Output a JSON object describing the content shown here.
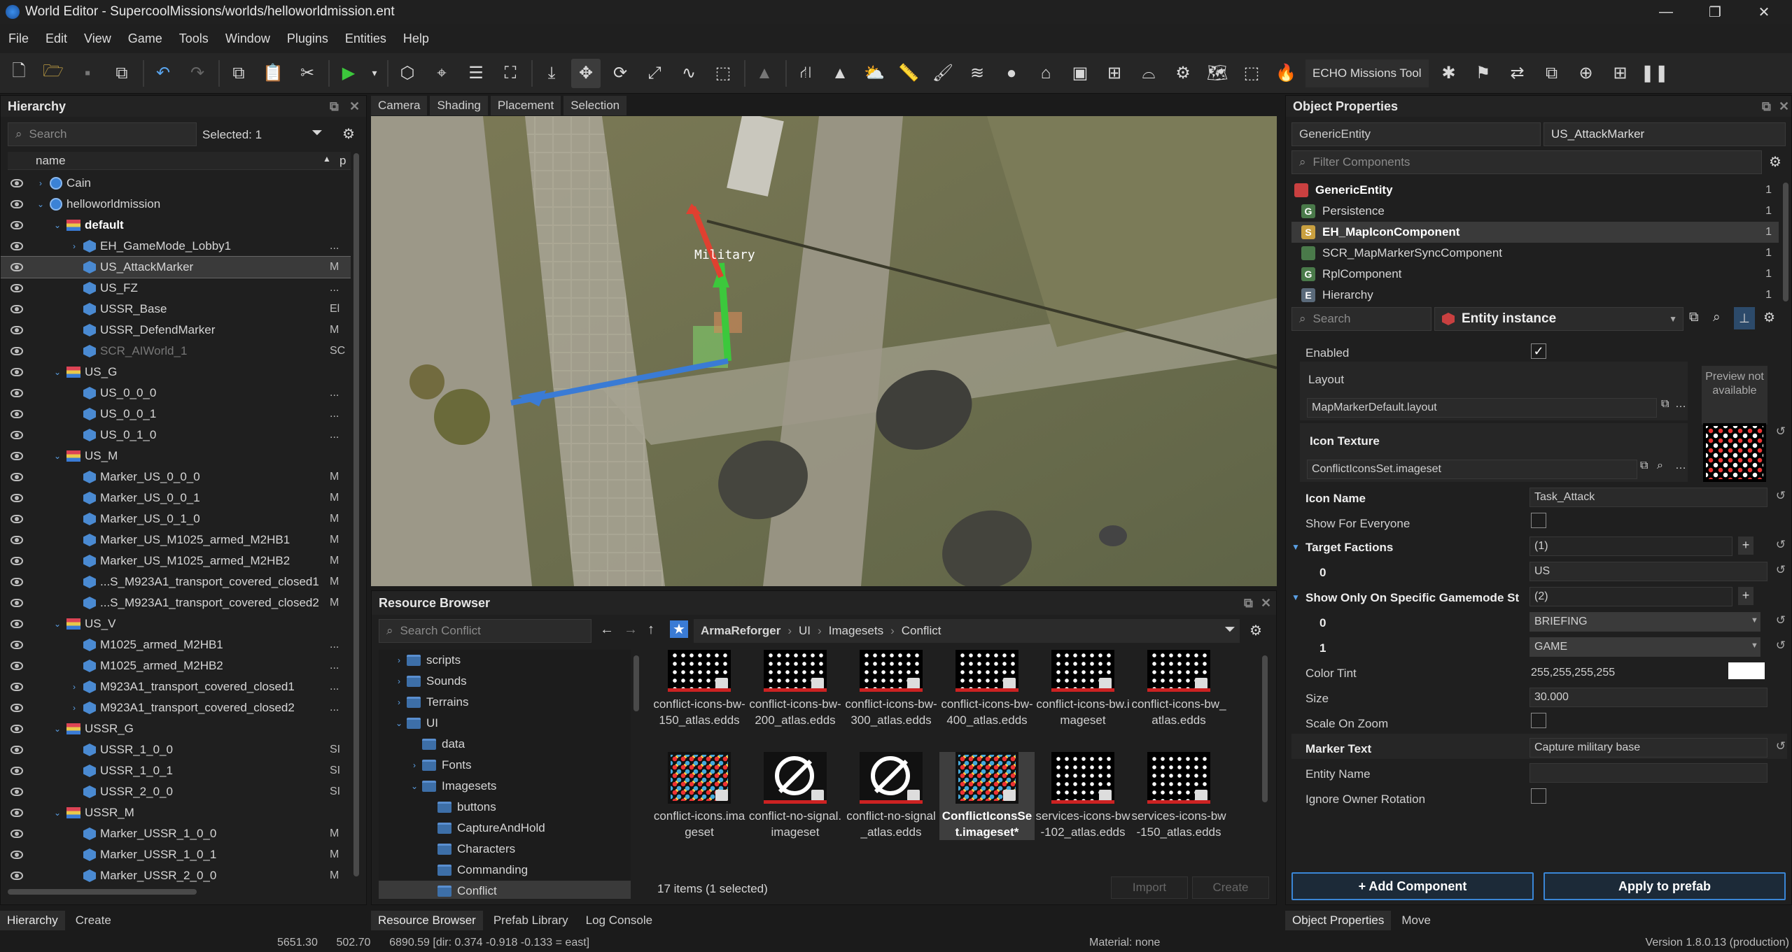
{
  "window": {
    "title": "World Editor - SupercoolMissions/worlds/helloworldmission.ent",
    "minimize": "—",
    "maximize": "❐",
    "close": "✕"
  },
  "menu": [
    "File",
    "Edit",
    "View",
    "Game",
    "Tools",
    "Window",
    "Plugins",
    "Entities",
    "Help"
  ],
  "toolbar": {
    "echo_label": "ECHO Missions Tool"
  },
  "hierarchy": {
    "title": "Hierarchy",
    "search_placeholder": "Search",
    "selected": "Selected: 1",
    "col_name": "name",
    "col_p": "p",
    "rows": [
      {
        "label": "Cain",
        "indent": 0,
        "kind": "globe",
        "exp": "›",
        "p": ""
      },
      {
        "label": "helloworldmission",
        "indent": 0,
        "kind": "globe",
        "exp": "⌄",
        "p": ""
      },
      {
        "label": "default",
        "indent": 1,
        "kind": "grp",
        "exp": "⌄",
        "p": "",
        "bold": true
      },
      {
        "label": "EH_GameMode_Lobby1",
        "indent": 2,
        "kind": "ent",
        "exp": "›",
        "p": "..."
      },
      {
        "label": "US_AttackMarker",
        "indent": 2,
        "kind": "ent",
        "exp": "",
        "p": "M",
        "selected": true
      },
      {
        "label": "US_FZ",
        "indent": 2,
        "kind": "ent",
        "exp": "",
        "p": "..."
      },
      {
        "label": "USSR_Base",
        "indent": 2,
        "kind": "ent",
        "exp": "",
        "p": "El"
      },
      {
        "label": "USSR_DefendMarker",
        "indent": 2,
        "kind": "ent",
        "exp": "",
        "p": "M"
      },
      {
        "label": "SCR_AIWorld_1",
        "indent": 2,
        "kind": "ent",
        "exp": "",
        "p": "SC",
        "dim": true
      },
      {
        "label": "US_G",
        "indent": 1,
        "kind": "grp",
        "exp": "⌄",
        "p": ""
      },
      {
        "label": "US_0_0_0",
        "indent": 2,
        "kind": "ent",
        "exp": "",
        "p": "..."
      },
      {
        "label": "US_0_0_1",
        "indent": 2,
        "kind": "ent",
        "exp": "",
        "p": "..."
      },
      {
        "label": "US_0_1_0",
        "indent": 2,
        "kind": "ent",
        "exp": "",
        "p": "..."
      },
      {
        "label": "US_M",
        "indent": 1,
        "kind": "grp",
        "exp": "⌄",
        "p": ""
      },
      {
        "label": "Marker_US_0_0_0",
        "indent": 2,
        "kind": "ent",
        "exp": "",
        "p": "M"
      },
      {
        "label": "Marker_US_0_0_1",
        "indent": 2,
        "kind": "ent",
        "exp": "",
        "p": "M"
      },
      {
        "label": "Marker_US_0_1_0",
        "indent": 2,
        "kind": "ent",
        "exp": "",
        "p": "M"
      },
      {
        "label": "Marker_US_M1025_armed_M2HB1",
        "indent": 2,
        "kind": "ent",
        "exp": "",
        "p": "M"
      },
      {
        "label": "Marker_US_M1025_armed_M2HB2",
        "indent": 2,
        "kind": "ent",
        "exp": "",
        "p": "M"
      },
      {
        "label": "...S_M923A1_transport_covered_closed1",
        "indent": 2,
        "kind": "ent",
        "exp": "",
        "p": "M"
      },
      {
        "label": "...S_M923A1_transport_covered_closed2",
        "indent": 2,
        "kind": "ent",
        "exp": "",
        "p": "M"
      },
      {
        "label": "US_V",
        "indent": 1,
        "kind": "grp",
        "exp": "⌄",
        "p": ""
      },
      {
        "label": "M1025_armed_M2HB1",
        "indent": 2,
        "kind": "ent",
        "exp": "",
        "p": "..."
      },
      {
        "label": "M1025_armed_M2HB2",
        "indent": 2,
        "kind": "ent",
        "exp": "",
        "p": "..."
      },
      {
        "label": "M923A1_transport_covered_closed1",
        "indent": 2,
        "kind": "ent",
        "exp": "›",
        "p": "..."
      },
      {
        "label": "M923A1_transport_covered_closed2",
        "indent": 2,
        "kind": "ent",
        "exp": "›",
        "p": "..."
      },
      {
        "label": "USSR_G",
        "indent": 1,
        "kind": "grp",
        "exp": "⌄",
        "p": ""
      },
      {
        "label": "USSR_1_0_0",
        "indent": 2,
        "kind": "ent",
        "exp": "",
        "p": "SI"
      },
      {
        "label": "USSR_1_0_1",
        "indent": 2,
        "kind": "ent",
        "exp": "",
        "p": "SI"
      },
      {
        "label": "USSR_2_0_0",
        "indent": 2,
        "kind": "ent",
        "exp": "",
        "p": "SI"
      },
      {
        "label": "USSR_M",
        "indent": 1,
        "kind": "grp",
        "exp": "⌄",
        "p": ""
      },
      {
        "label": "Marker_USSR_1_0_0",
        "indent": 2,
        "kind": "ent",
        "exp": "",
        "p": "M"
      },
      {
        "label": "Marker_USSR_1_0_1",
        "indent": 2,
        "kind": "ent",
        "exp": "",
        "p": "M"
      },
      {
        "label": "Marker_USSR_2_0_0",
        "indent": 2,
        "kind": "ent",
        "exp": "",
        "p": "M"
      }
    ],
    "tabs": [
      "Hierarchy",
      "Create"
    ]
  },
  "viewport": {
    "tabs": [
      "Camera",
      "Shading",
      "Placement",
      "Selection"
    ],
    "marker_label": "Military"
  },
  "resource_browser": {
    "title": "Resource Browser",
    "search_placeholder": "Search Conflict",
    "breadcrumb": [
      "ArmaReforger",
      "UI",
      "Imagesets",
      "Conflict"
    ],
    "tree": [
      {
        "label": "scripts",
        "indent": 1,
        "exp": "›"
      },
      {
        "label": "Sounds",
        "indent": 1,
        "exp": "›"
      },
      {
        "label": "Terrains",
        "indent": 1,
        "exp": "›"
      },
      {
        "label": "UI",
        "indent": 1,
        "exp": "⌄"
      },
      {
        "label": "data",
        "indent": 2,
        "exp": ""
      },
      {
        "label": "Fonts",
        "indent": 2,
        "exp": "›"
      },
      {
        "label": "Imagesets",
        "indent": 2,
        "exp": "⌄"
      },
      {
        "label": "buttons",
        "indent": 3,
        "exp": ""
      },
      {
        "label": "CaptureAndHold",
        "indent": 3,
        "exp": ""
      },
      {
        "label": "Characters",
        "indent": 3,
        "exp": ""
      },
      {
        "label": "Commanding",
        "indent": 3,
        "exp": ""
      },
      {
        "label": "Conflict",
        "indent": 3,
        "exp": "",
        "selected": true
      }
    ],
    "items": [
      {
        "label": "conflict-icons-bw-150_atlas.edds",
        "style": "dots"
      },
      {
        "label": "conflict-icons-bw-200_atlas.edds",
        "style": "dots"
      },
      {
        "label": "conflict-icons-bw-300_atlas.edds",
        "style": "dots"
      },
      {
        "label": "conflict-icons-bw-400_atlas.edds",
        "style": "dots"
      },
      {
        "label": "conflict-icons-bw.imageset",
        "style": "dots"
      },
      {
        "label": "conflict-icons-bw_atlas.edds",
        "style": "dots"
      },
      {
        "label": "conflict-icons.imageset",
        "style": "color"
      },
      {
        "label": "conflict-no-signal.imageset",
        "style": "nosig"
      },
      {
        "label": "conflict-no-signal_atlas.edds",
        "style": "nosig"
      },
      {
        "label": "ConflictIconsSet.imageset*",
        "style": "color",
        "selected": true
      },
      {
        "label": "services-icons-bw-102_atlas.edds",
        "style": "dots"
      },
      {
        "label": "services-icons-bw-150_atlas.edds",
        "style": "dots"
      }
    ],
    "status": "17 items (1 selected)",
    "import_label": "Import",
    "create_label": "Create",
    "tabs": [
      "Resource Browser",
      "Prefab Library",
      "Log Console"
    ]
  },
  "object_properties": {
    "title": "Object Properties",
    "class_name": "GenericEntity",
    "entity_name": "US_AttackMarker",
    "filter_placeholder": "Filter Components",
    "components": [
      {
        "label": "GenericEntity",
        "icon": "",
        "count": "1",
        "bold": true
      },
      {
        "label": "Persistence",
        "icon": "G",
        "count": "1"
      },
      {
        "label": "EH_MapIconComponent",
        "icon": "S",
        "count": "1",
        "bold": true,
        "selected": true
      },
      {
        "label": "SCR_MapMarkerSyncComponent",
        "icon": "",
        "count": "1"
      },
      {
        "label": "RplComponent",
        "icon": "G",
        "count": "1"
      },
      {
        "label": "Hierarchy",
        "icon": "E",
        "count": "1"
      }
    ],
    "search_placeholder": "Search",
    "instance_label": "Entity instance",
    "props": {
      "enabled": "Enabled",
      "layout": "Layout",
      "layout_value": "MapMarkerDefault.layout",
      "preview": "Preview not available",
      "icon_texture": "Icon Texture",
      "icon_texture_value": "ConflictIconsSet.imageset",
      "icon_name": "Icon Name",
      "icon_name_value": "Task_Attack",
      "show_for_everyone": "Show For Everyone",
      "target_factions": "Target Factions",
      "target_factions_count": "(1)",
      "tf_index": "0",
      "tf_value": "US",
      "show_only": "Show Only On Specific Gamemode St",
      "show_only_count": "(2)",
      "so_index0": "0",
      "so_value0": "BRIEFING",
      "so_index1": "1",
      "so_value1": "GAME",
      "color_tint": "Color Tint",
      "color_tint_value": "255,255,255,255",
      "size": "Size",
      "size_value": "30.000",
      "scale_on_zoom": "Scale On Zoom",
      "marker_text": "Marker Text",
      "marker_text_value": "Capture military base",
      "entity_name": "Entity Name",
      "ignore_owner_rotation": "Ignore Owner Rotation"
    },
    "add_component": "+ Add Component",
    "apply_prefab": "Apply to prefab",
    "tabs": [
      "Object Properties",
      "Move"
    ]
  },
  "statusbar": {
    "coords": "5651.30      502.70      6890.59 [dir: 0.374 -0.918 -0.133 = east]",
    "material": "Material: none",
    "version": "Version 1.8.0.13 (production)"
  }
}
